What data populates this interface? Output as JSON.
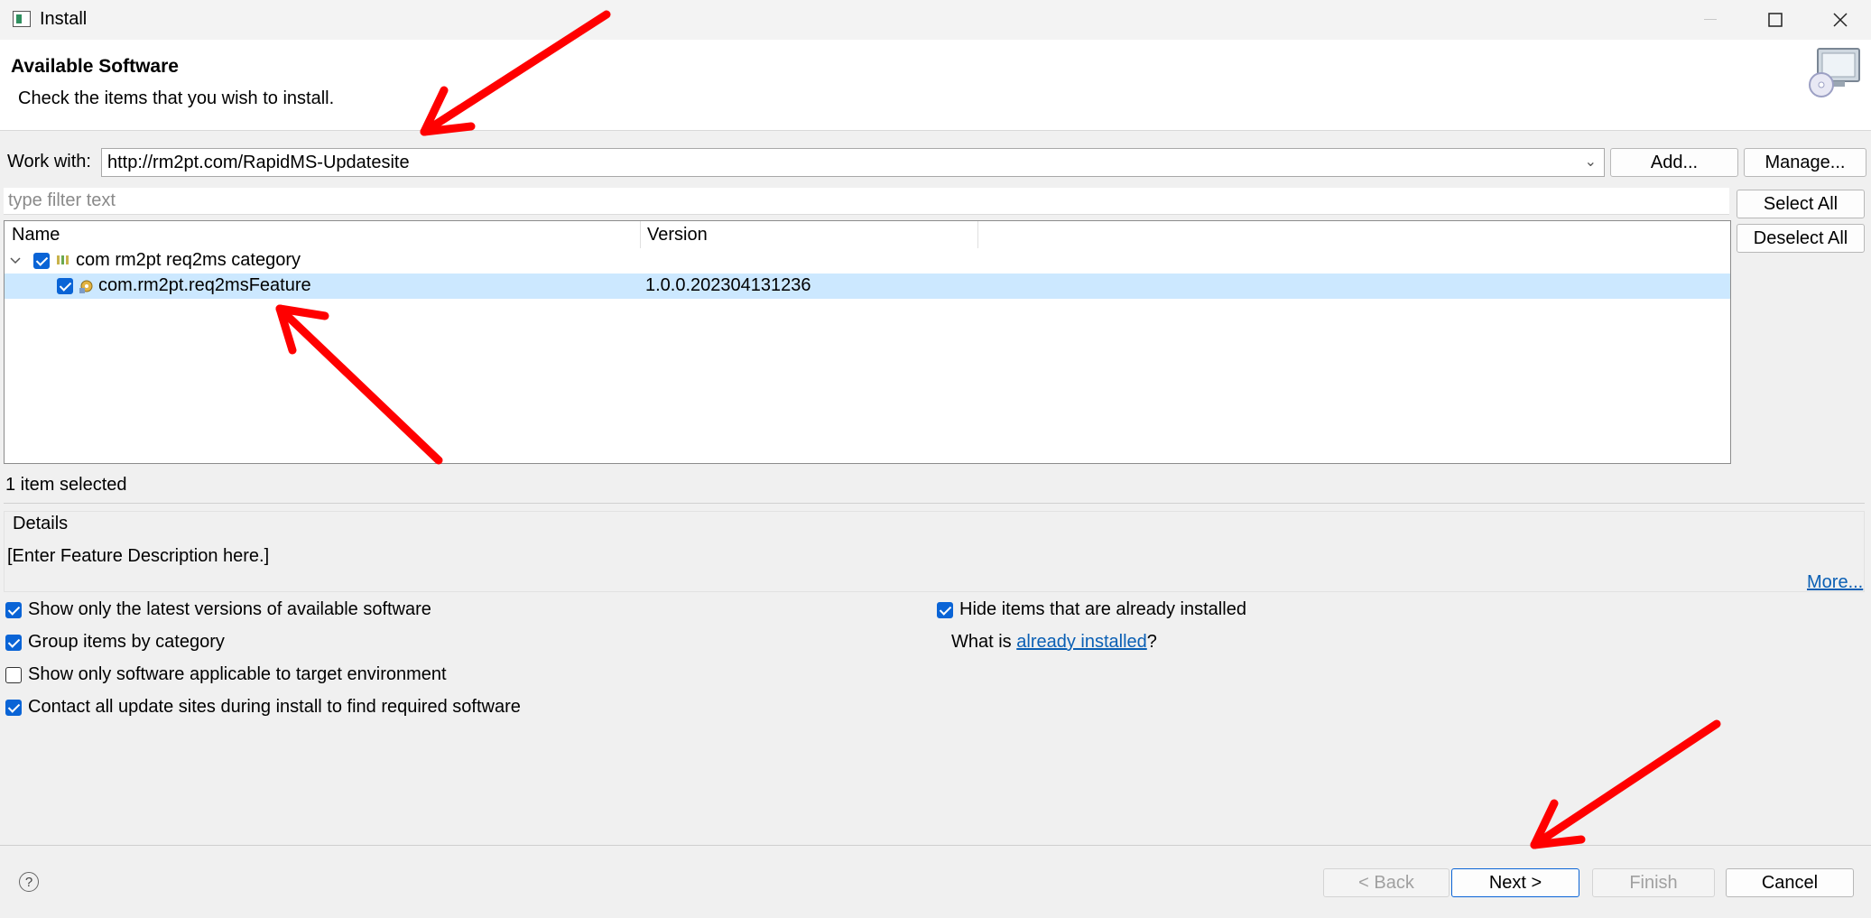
{
  "window": {
    "title": "Install",
    "icon": "install-wizard-icon"
  },
  "header": {
    "title": "Available Software",
    "subtitle": "Check the items that you wish to install.",
    "graphic": "install-software-banner-icon"
  },
  "work_with": {
    "label": "Work with:",
    "value": "http://rm2pt.com/RapidMS-Updatesite",
    "add_label": "Add...",
    "manage_label": "Manage..."
  },
  "filter": {
    "placeholder": "type filter text"
  },
  "selection_buttons": {
    "select_all": "Select All",
    "deselect_all": "Deselect All"
  },
  "tree": {
    "columns": [
      "Name",
      "Version"
    ],
    "rows": [
      {
        "name": "com rm2pt req2ms category",
        "version": "",
        "checked": true,
        "expanded": true,
        "icon": "category-icon"
      },
      {
        "name": "com.rm2pt.req2msFeature",
        "version": "1.0.0.202304131236",
        "checked": true,
        "selected": true,
        "icon": "feature-icon"
      }
    ]
  },
  "status": "1 item selected",
  "details": {
    "label": "Details",
    "text": "[Enter Feature Description here.]",
    "more_link": "More..."
  },
  "options": {
    "latest_versions": {
      "label": "Show only the latest versions of available software",
      "checked": true
    },
    "group_by_category": {
      "label": "Group items by category",
      "checked": true
    },
    "target_env": {
      "label": "Show only software applicable to target environment",
      "checked": false
    },
    "contact_sites": {
      "label": "Contact all update sites during install to find required software",
      "checked": true
    },
    "hide_installed": {
      "label": "Hide items that are already installed",
      "checked": true
    }
  },
  "what_is": {
    "prefix": "What is ",
    "link": "already installed",
    "suffix": "?"
  },
  "footer": {
    "back": "< Back",
    "next": "Next >",
    "finish": "Finish",
    "cancel": "Cancel"
  },
  "colors": {
    "accent": "#0a64d6",
    "selection": "#cce8ff",
    "annotation_arrow": "#ff0000",
    "link": "#0a5fb4"
  }
}
